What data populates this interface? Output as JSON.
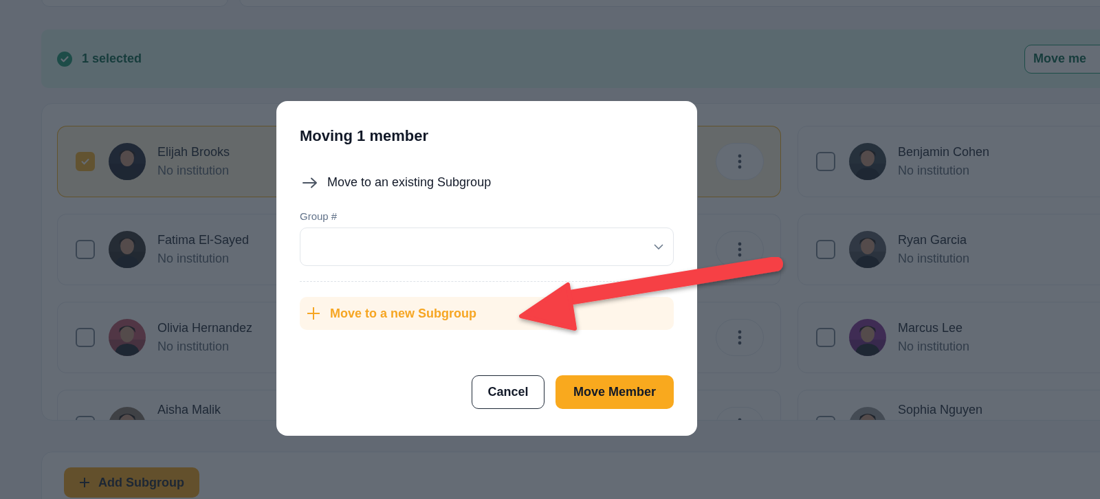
{
  "selection_bar": {
    "count_label": "1 selected",
    "action": "Move me"
  },
  "columns": [
    {
      "show_menu": true,
      "members": [
        {
          "name": "Elijah Brooks",
          "institution": "No institution",
          "selected": true
        },
        {
          "name": "Fatima El-Sayed",
          "institution": "No institution",
          "selected": false
        },
        {
          "name": "Olivia Hernandez",
          "institution": "No institution",
          "selected": false
        },
        {
          "name": "Aisha Malik",
          "selected": false
        }
      ]
    },
    {
      "show_menu": false,
      "members": [
        {
          "name": "Benjamin Cohen",
          "institution": "No institution",
          "selected": false
        },
        {
          "name": "Ryan Garcia",
          "institution": "No institution",
          "selected": false
        },
        {
          "name": "Marcus Lee",
          "institution": "No institution",
          "selected": false
        },
        {
          "name": "Sophia Nguyen",
          "selected": false
        }
      ]
    }
  ],
  "dialog": {
    "title": "Moving 1 member",
    "existing_option": "Move to an existing Subgroup",
    "group_label": "Group #",
    "new_option": "Move to a new Subgroup",
    "buttons": [
      {
        "label": "Cancel",
        "kind": "secondary"
      },
      {
        "label": "Move Member",
        "kind": "primary"
      }
    ]
  },
  "footer": {
    "add_button": "Add Subgroup"
  }
}
